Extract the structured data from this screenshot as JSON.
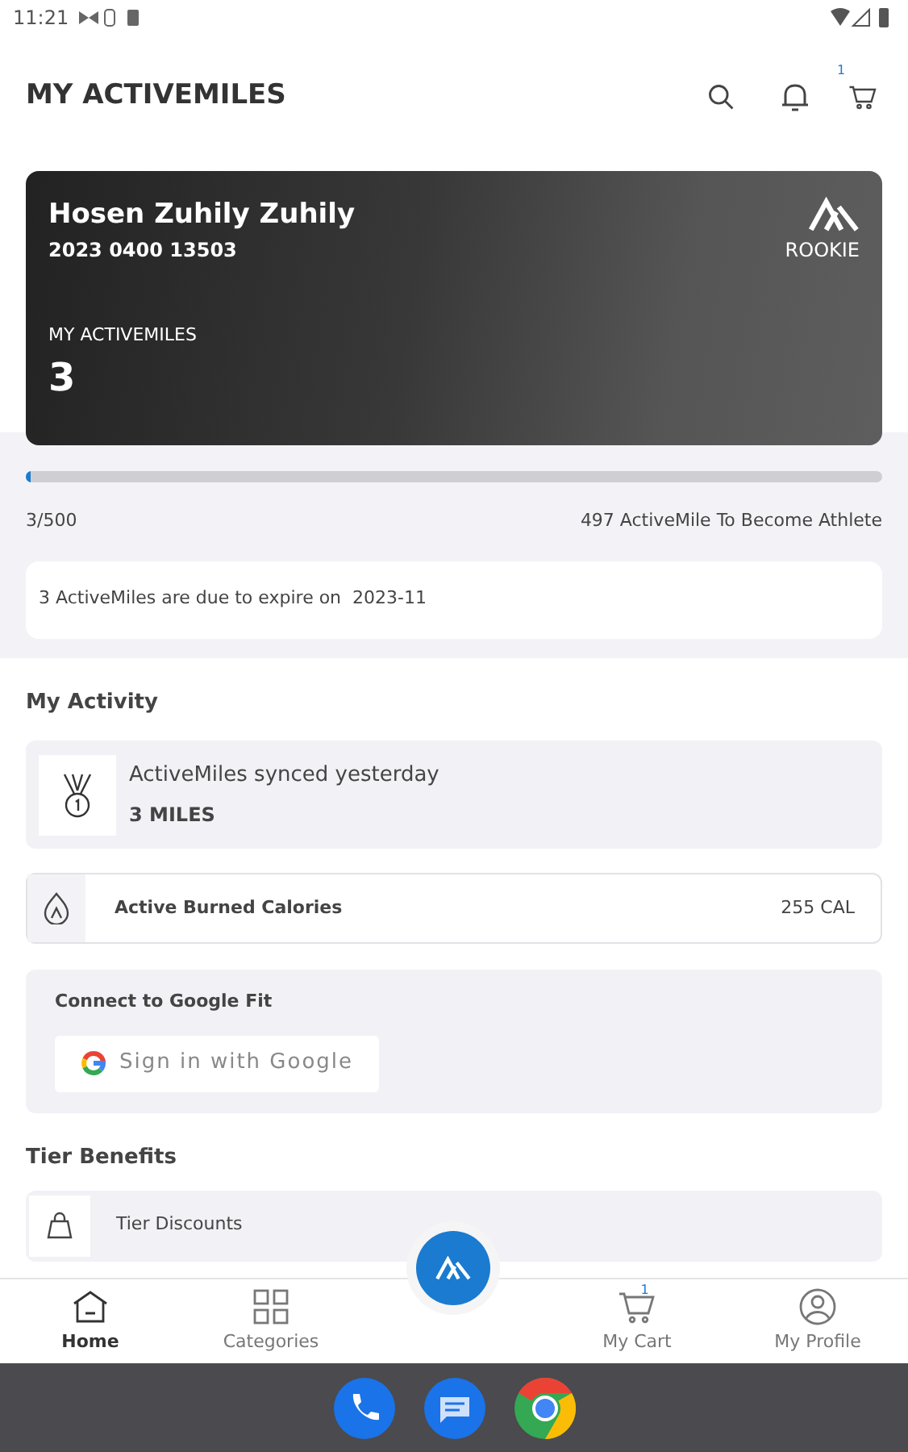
{
  "status_bar": {
    "time": "11:21"
  },
  "header": {
    "title": "MY ACTIVEMILES",
    "cart_badge": "1"
  },
  "member_card": {
    "name": "Hosen Zuhily Zuhily",
    "number": "2023 0400 13503",
    "tier": "ROOKIE",
    "miles_label": "MY ACTIVEMILES",
    "miles": "3"
  },
  "progress": {
    "level": 0.006,
    "count": "3/500",
    "remaining": "497 ActiveMile To Become Athlete"
  },
  "expiry_notice": "3 ActiveMiles are due to expire on  2023-11",
  "my_activity": {
    "title": "My Activity",
    "synced": {
      "text": "ActiveMiles synced yesterday",
      "miles": "3 MILES"
    },
    "calories": {
      "label": "Active Burned Calories",
      "value": "255 CAL"
    },
    "google_fit": {
      "title": "Connect to Google Fit",
      "button": "Sign in with Google"
    }
  },
  "tier_benefits": {
    "title": "Tier Benefits",
    "items": [
      {
        "label": "Tier Discounts"
      }
    ]
  },
  "bottom_nav": [
    {
      "label": "Home",
      "kind": "home",
      "selected": true
    },
    {
      "label": "Categories",
      "kind": "categories",
      "selected": false
    },
    {
      "label": "My Cart",
      "kind": "cart",
      "selected": false,
      "badge": "1"
    },
    {
      "label": "My Profile",
      "kind": "profile",
      "selected": false
    }
  ]
}
